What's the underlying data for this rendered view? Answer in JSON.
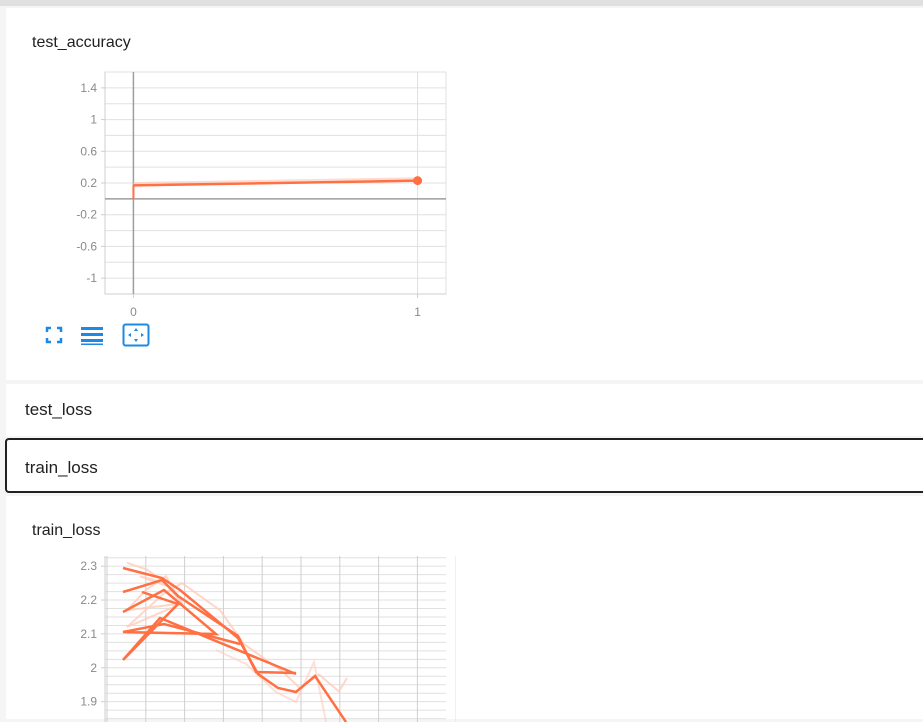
{
  "cards": [
    {
      "title": "test_accuracy",
      "toolbar": {
        "fullscreen_icon": "fullscreen-icon",
        "data_table_icon": "list-icon",
        "fit_domain_icon": "fit-domain-icon"
      }
    },
    {
      "title": "train_loss"
    }
  ],
  "sections": {
    "test_loss_label": "test_loss",
    "train_loss_label": "train_loss"
  },
  "colors": {
    "series": "#ff7043",
    "series_light": "#ffccbc",
    "axis": "#9e9e9e",
    "grid": "#e0e0e0",
    "toolbar_icon": "#1e88e5"
  },
  "chart_data": [
    {
      "type": "line",
      "title": "test_accuracy",
      "x": [
        0,
        1
      ],
      "series": [
        {
          "values": [
            0.17,
            0.23
          ]
        }
      ],
      "xticks": [
        "0",
        "1"
      ],
      "yticks": [
        "1.4",
        "1",
        "0.6",
        "0.2",
        "-0.2",
        "-0.6",
        "-1"
      ],
      "ytick_values": [
        1.4,
        1,
        0.6,
        0.2,
        -0.2,
        -0.6,
        -1
      ],
      "xlim": [
        -0.1,
        1.1
      ],
      "ylim": [
        -1.2,
        1.6
      ],
      "grid": true
    },
    {
      "type": "line",
      "title": "train_loss",
      "x": [
        0,
        1,
        2,
        3,
        4,
        5,
        6,
        7,
        8,
        9,
        10,
        11,
        12,
        13,
        14,
        15,
        16,
        17,
        18,
        19
      ],
      "series": [
        {
          "values": [
            2.29,
            2.27,
            2.23,
            2.25,
            2.22,
            2.17,
            2.15,
            2.21,
            2.25,
            2.17,
            2.1,
            2.2,
            2.23,
            2.15,
            2.05,
            1.97,
            1.92,
            1.96,
            1.91,
            1.95
          ]
        }
      ],
      "yticks": [
        "2.3",
        "2.2",
        "2.1",
        "2",
        "1.9"
      ],
      "ytick_values": [
        2.3,
        2.2,
        2.1,
        2.0,
        1.9
      ],
      "ylim": [
        1.84,
        2.33
      ],
      "grid": true
    }
  ]
}
